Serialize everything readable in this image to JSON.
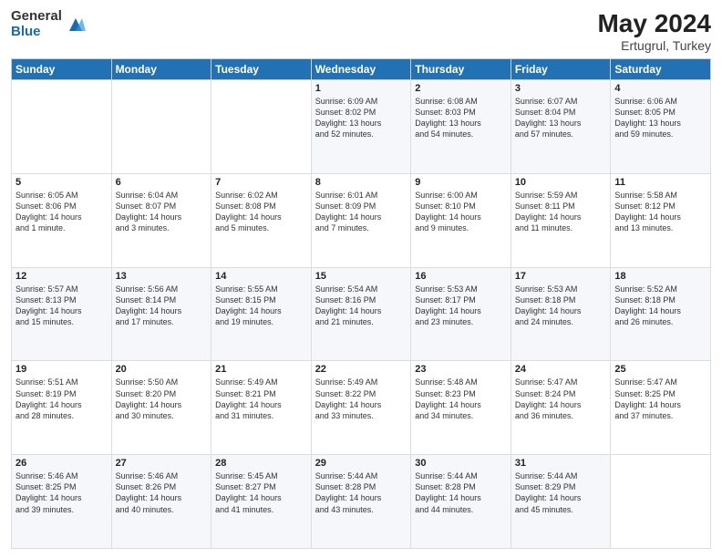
{
  "logo": {
    "general": "General",
    "blue": "Blue"
  },
  "header": {
    "month_year": "May 2024",
    "location": "Ertugrul, Turkey"
  },
  "days_of_week": [
    "Sunday",
    "Monday",
    "Tuesday",
    "Wednesday",
    "Thursday",
    "Friday",
    "Saturday"
  ],
  "weeks": [
    [
      {
        "day": "",
        "info": ""
      },
      {
        "day": "",
        "info": ""
      },
      {
        "day": "",
        "info": ""
      },
      {
        "day": "1",
        "info": "Sunrise: 6:09 AM\nSunset: 8:02 PM\nDaylight: 13 hours\nand 52 minutes."
      },
      {
        "day": "2",
        "info": "Sunrise: 6:08 AM\nSunset: 8:03 PM\nDaylight: 13 hours\nand 54 minutes."
      },
      {
        "day": "3",
        "info": "Sunrise: 6:07 AM\nSunset: 8:04 PM\nDaylight: 13 hours\nand 57 minutes."
      },
      {
        "day": "4",
        "info": "Sunrise: 6:06 AM\nSunset: 8:05 PM\nDaylight: 13 hours\nand 59 minutes."
      }
    ],
    [
      {
        "day": "5",
        "info": "Sunrise: 6:05 AM\nSunset: 8:06 PM\nDaylight: 14 hours\nand 1 minute."
      },
      {
        "day": "6",
        "info": "Sunrise: 6:04 AM\nSunset: 8:07 PM\nDaylight: 14 hours\nand 3 minutes."
      },
      {
        "day": "7",
        "info": "Sunrise: 6:02 AM\nSunset: 8:08 PM\nDaylight: 14 hours\nand 5 minutes."
      },
      {
        "day": "8",
        "info": "Sunrise: 6:01 AM\nSunset: 8:09 PM\nDaylight: 14 hours\nand 7 minutes."
      },
      {
        "day": "9",
        "info": "Sunrise: 6:00 AM\nSunset: 8:10 PM\nDaylight: 14 hours\nand 9 minutes."
      },
      {
        "day": "10",
        "info": "Sunrise: 5:59 AM\nSunset: 8:11 PM\nDaylight: 14 hours\nand 11 minutes."
      },
      {
        "day": "11",
        "info": "Sunrise: 5:58 AM\nSunset: 8:12 PM\nDaylight: 14 hours\nand 13 minutes."
      }
    ],
    [
      {
        "day": "12",
        "info": "Sunrise: 5:57 AM\nSunset: 8:13 PM\nDaylight: 14 hours\nand 15 minutes."
      },
      {
        "day": "13",
        "info": "Sunrise: 5:56 AM\nSunset: 8:14 PM\nDaylight: 14 hours\nand 17 minutes."
      },
      {
        "day": "14",
        "info": "Sunrise: 5:55 AM\nSunset: 8:15 PM\nDaylight: 14 hours\nand 19 minutes."
      },
      {
        "day": "15",
        "info": "Sunrise: 5:54 AM\nSunset: 8:16 PM\nDaylight: 14 hours\nand 21 minutes."
      },
      {
        "day": "16",
        "info": "Sunrise: 5:53 AM\nSunset: 8:17 PM\nDaylight: 14 hours\nand 23 minutes."
      },
      {
        "day": "17",
        "info": "Sunrise: 5:53 AM\nSunset: 8:18 PM\nDaylight: 14 hours\nand 24 minutes."
      },
      {
        "day": "18",
        "info": "Sunrise: 5:52 AM\nSunset: 8:18 PM\nDaylight: 14 hours\nand 26 minutes."
      }
    ],
    [
      {
        "day": "19",
        "info": "Sunrise: 5:51 AM\nSunset: 8:19 PM\nDaylight: 14 hours\nand 28 minutes."
      },
      {
        "day": "20",
        "info": "Sunrise: 5:50 AM\nSunset: 8:20 PM\nDaylight: 14 hours\nand 30 minutes."
      },
      {
        "day": "21",
        "info": "Sunrise: 5:49 AM\nSunset: 8:21 PM\nDaylight: 14 hours\nand 31 minutes."
      },
      {
        "day": "22",
        "info": "Sunrise: 5:49 AM\nSunset: 8:22 PM\nDaylight: 14 hours\nand 33 minutes."
      },
      {
        "day": "23",
        "info": "Sunrise: 5:48 AM\nSunset: 8:23 PM\nDaylight: 14 hours\nand 34 minutes."
      },
      {
        "day": "24",
        "info": "Sunrise: 5:47 AM\nSunset: 8:24 PM\nDaylight: 14 hours\nand 36 minutes."
      },
      {
        "day": "25",
        "info": "Sunrise: 5:47 AM\nSunset: 8:25 PM\nDaylight: 14 hours\nand 37 minutes."
      }
    ],
    [
      {
        "day": "26",
        "info": "Sunrise: 5:46 AM\nSunset: 8:25 PM\nDaylight: 14 hours\nand 39 minutes."
      },
      {
        "day": "27",
        "info": "Sunrise: 5:46 AM\nSunset: 8:26 PM\nDaylight: 14 hours\nand 40 minutes."
      },
      {
        "day": "28",
        "info": "Sunrise: 5:45 AM\nSunset: 8:27 PM\nDaylight: 14 hours\nand 41 minutes."
      },
      {
        "day": "29",
        "info": "Sunrise: 5:44 AM\nSunset: 8:28 PM\nDaylight: 14 hours\nand 43 minutes."
      },
      {
        "day": "30",
        "info": "Sunrise: 5:44 AM\nSunset: 8:28 PM\nDaylight: 14 hours\nand 44 minutes."
      },
      {
        "day": "31",
        "info": "Sunrise: 5:44 AM\nSunset: 8:29 PM\nDaylight: 14 hours\nand 45 minutes."
      },
      {
        "day": "",
        "info": ""
      }
    ]
  ]
}
